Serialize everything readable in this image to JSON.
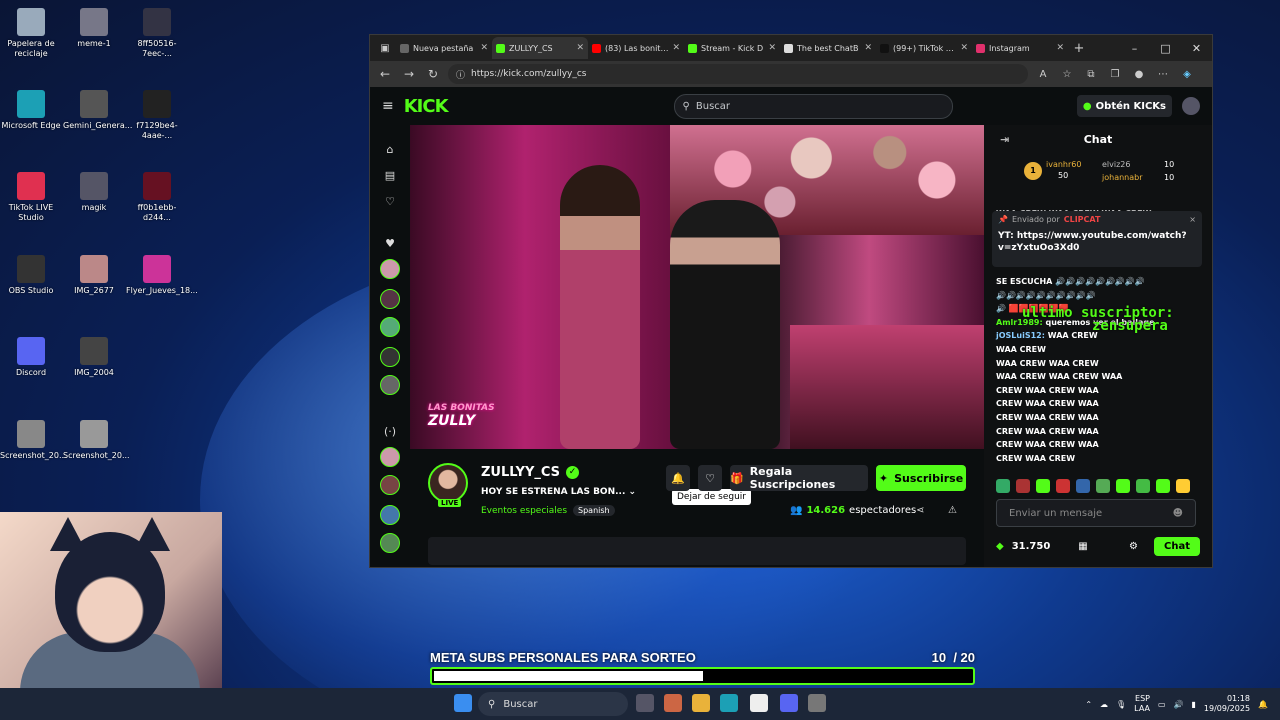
{
  "desktop": {
    "icons": [
      {
        "label": "Papelera de reciclaje",
        "color": "#9ab"
      },
      {
        "label": "meme-1",
        "color": "#778"
      },
      {
        "label": "8ff50516-7eec-...",
        "color": "#334"
      },
      {
        "label": "Microsoft Edge",
        "color": "#1ca0b5"
      },
      {
        "label": "Gemini_Genera...",
        "color": "#555"
      },
      {
        "label": "f7129be4-4aae-...",
        "color": "#222"
      },
      {
        "label": "TikTok LIVE Studio",
        "color": "#e03050"
      },
      {
        "label": "magik",
        "color": "#556"
      },
      {
        "label": "ff0b1ebb-d244...",
        "color": "#612"
      },
      {
        "label": "OBS Studio",
        "color": "#333"
      },
      {
        "label": "IMG_2677",
        "color": "#b88"
      },
      {
        "label": "Flyer_Jueves_18...",
        "color": "#c39"
      },
      {
        "label": "Discord",
        "color": "#5865f2"
      },
      {
        "label": "IMG_2004",
        "color": "#444"
      },
      {
        "label": "Screenshot_20...",
        "color": "#888"
      },
      {
        "label": "Screenshot_20...",
        "color": "#999"
      }
    ]
  },
  "browser": {
    "tabs": [
      {
        "title": "Nueva pestaña",
        "color": "#666",
        "active": false
      },
      {
        "title": "ZULLYY_CS",
        "color": "#53fc18",
        "active": true
      },
      {
        "title": "(83) Las bonitas",
        "color": "#f00",
        "active": false
      },
      {
        "title": "Stream - Kick D",
        "color": "#53fc18",
        "active": false
      },
      {
        "title": "The best ChatB",
        "color": "#ddd",
        "active": false
      },
      {
        "title": "(99+) TikTok - M",
        "color": "#111",
        "active": false
      },
      {
        "title": "Instagram",
        "color": "#e1306c",
        "active": false
      }
    ],
    "url": "https://kick.com/zullyy_cs"
  },
  "kick": {
    "logo": "KICK",
    "search_placeholder": "Buscar",
    "kicks_btn": "Obtén KICKs",
    "video_logo_line1": "LAS BONITAS",
    "video_logo_line2": "ZULLY"
  },
  "stream": {
    "name": "ZULLYY_CS",
    "title": "HOY SE ESTRENA LAS BON...",
    "category": "Eventos especiales",
    "language": "Spanish",
    "live_label": "LIVE",
    "tooltip": "Dejar de seguir",
    "gift_btn": "Regala Suscripciones",
    "subscribe_btn": "Suscribirse",
    "viewers": "14.626",
    "viewers_label": "espectadores"
  },
  "chat": {
    "header": "Chat",
    "leaders": [
      {
        "name": "ivanhr60",
        "value": "50",
        "rank": "1"
      },
      {
        "name": "elviz26",
        "value": "10"
      },
      {
        "name": "johannabr",
        "value": "10"
      }
    ],
    "pinned_by": "Enviado por",
    "pinned_user": "CLIPCAT",
    "pinned_text": "YT: https://www.youtube.com/watch?v=zYxtuOo3Xd0",
    "top_msg": "WAA CREW WAA CREW WAA CREW",
    "se_escucha": "SE ESCUCHA",
    "msg1_user": "Amlr1989:",
    "msg1_text": "queremos ver el ballage",
    "msg2_user": "jOSLuiS12:",
    "msg2_text": "WAA CREW",
    "crew_lines": [
      "WAA CREW",
      "WAA CREW  WAA CREW",
      "WAA CREW  WAA CREW  WAA",
      "CREW  WAA CREW  WAA",
      "CREW  WAA CREW  WAA",
      "CREW  WAA CREW  WAA",
      "CREW  WAA CREW  WAA",
      "CREW  WAA CREW  WAA",
      "CREW  WAA CREW"
    ],
    "overlay_line1": "ultimo suscriptor:",
    "overlay_line2": "zensupera",
    "input_placeholder": "Enviar un mensaje",
    "kicks_balance": "31.750",
    "send_btn": "Chat"
  },
  "overlay": {
    "goal_title": "META SUBS PERSONALES PARA SORTEO",
    "goal_current": "10",
    "goal_target": "/ 20",
    "goal_progress": 0.5
  },
  "taskbar": {
    "search": "Buscar",
    "lang_line1": "ESP",
    "lang_line2": "LAA",
    "time": "01:18",
    "date": "19/09/2025"
  }
}
